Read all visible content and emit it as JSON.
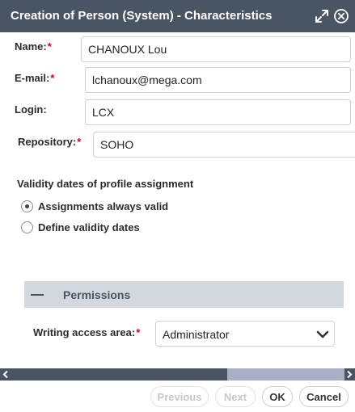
{
  "dialog": {
    "title": "Creation of Person (System) - Characteristics",
    "colors": {
      "titlebar": "#4a5563",
      "required": "#d0021b",
      "section_header": "#d3d8df"
    },
    "icons": [
      "expand-icon",
      "close-icon"
    ]
  },
  "form": {
    "name": {
      "label": "Name:",
      "required": "*",
      "value": "CHANOUX Lou"
    },
    "email": {
      "label": "E-mail:",
      "required": "*",
      "value": "lchanoux@mega.com"
    },
    "login": {
      "label": "Login:",
      "value": "LCX"
    },
    "repository": {
      "label": "Repository:",
      "required": "*",
      "value": "SOHO"
    }
  },
  "validity": {
    "heading": "Validity dates of profile assignment",
    "options": [
      {
        "label": "Assignments always valid",
        "selected": true
      },
      {
        "label": "Define validity dates",
        "selected": false
      }
    ]
  },
  "permissions": {
    "title": "Permissions",
    "writing_access": {
      "label": "Writing access area:",
      "required": "*",
      "value": "Administrator"
    }
  },
  "footer": {
    "previous": "Previous",
    "next": "Next",
    "ok": "OK",
    "cancel": "Cancel"
  }
}
